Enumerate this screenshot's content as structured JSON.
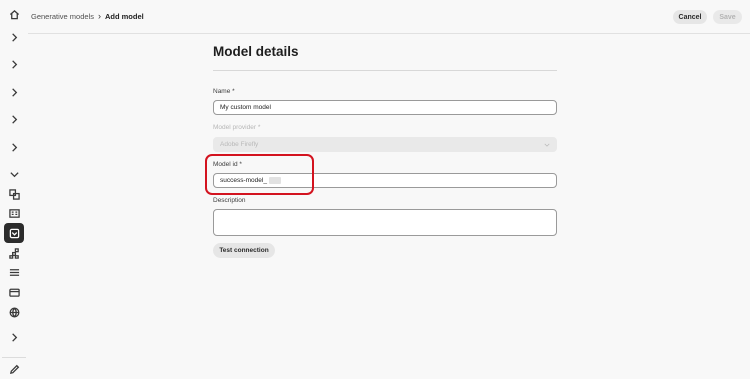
{
  "header": {
    "breadcrumb_parent": "Generative models",
    "breadcrumb_separator": "›",
    "breadcrumb_current": "Add model",
    "cancel_label": "Cancel",
    "save_label": "Save"
  },
  "rail": {
    "icons": [
      "home-icon",
      "chevron-right-icon",
      "chevron-right-icon",
      "chevron-right-icon",
      "chevron-right-icon",
      "chevron-right-icon",
      "chevron-down-icon",
      "translate-icon",
      "catalog-icon",
      "model-icon",
      "hierarchy-icon",
      "list-icon",
      "folder-icon",
      "globe-icon",
      "chevron-right-icon",
      "edit-icon"
    ],
    "active_icon": "model-icon"
  },
  "form": {
    "title": "Model details",
    "name_label": "Name",
    "name_value": "My custom model",
    "provider_label": "Model provider",
    "provider_value": "Adobe Firefly",
    "model_id_label": "Model id",
    "model_id_value": "success-model_",
    "description_label": "Description",
    "description_value": "",
    "required_marker": "*",
    "test_connection_label": "Test connection"
  },
  "colors": {
    "accent_dark": "#2c2c2c",
    "highlight_red": "#d3131f",
    "background": "#f8f8f8"
  }
}
